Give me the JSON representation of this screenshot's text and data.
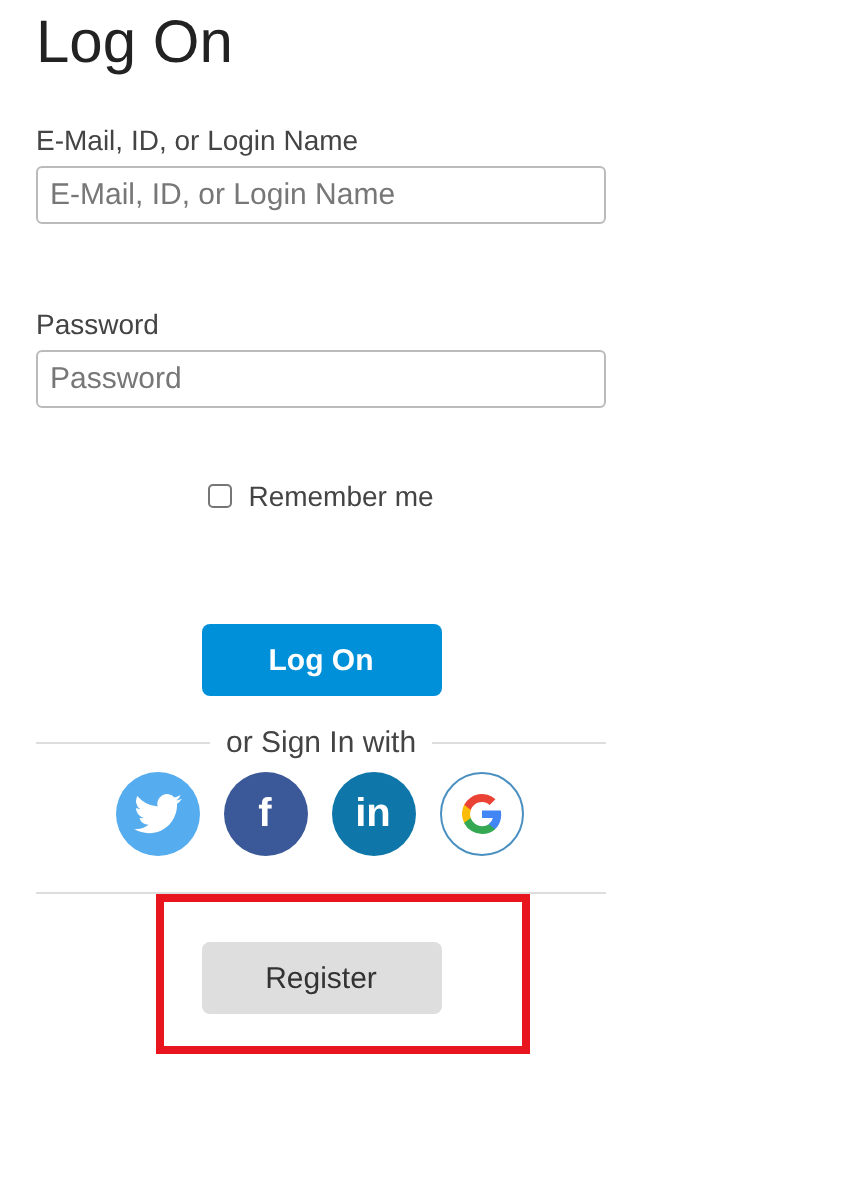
{
  "title": "Log On",
  "fields": [
    {
      "label": "E-Mail, ID, or Login Name",
      "placeholder": "E-Mail, ID, or Login Name"
    },
    {
      "label": "Password",
      "placeholder": "Password"
    }
  ],
  "remember": {
    "label": "Remember me",
    "checked": false
  },
  "submit": "Log On",
  "divider_text": "or Sign In with",
  "social": [
    {
      "kind": "twitter"
    },
    {
      "kind": "facebook",
      "glyph": "f"
    },
    {
      "kind": "linkedin",
      "glyph": "in"
    },
    {
      "kind": "google"
    }
  ],
  "register": {
    "label": "Register",
    "highlighted": true
  }
}
